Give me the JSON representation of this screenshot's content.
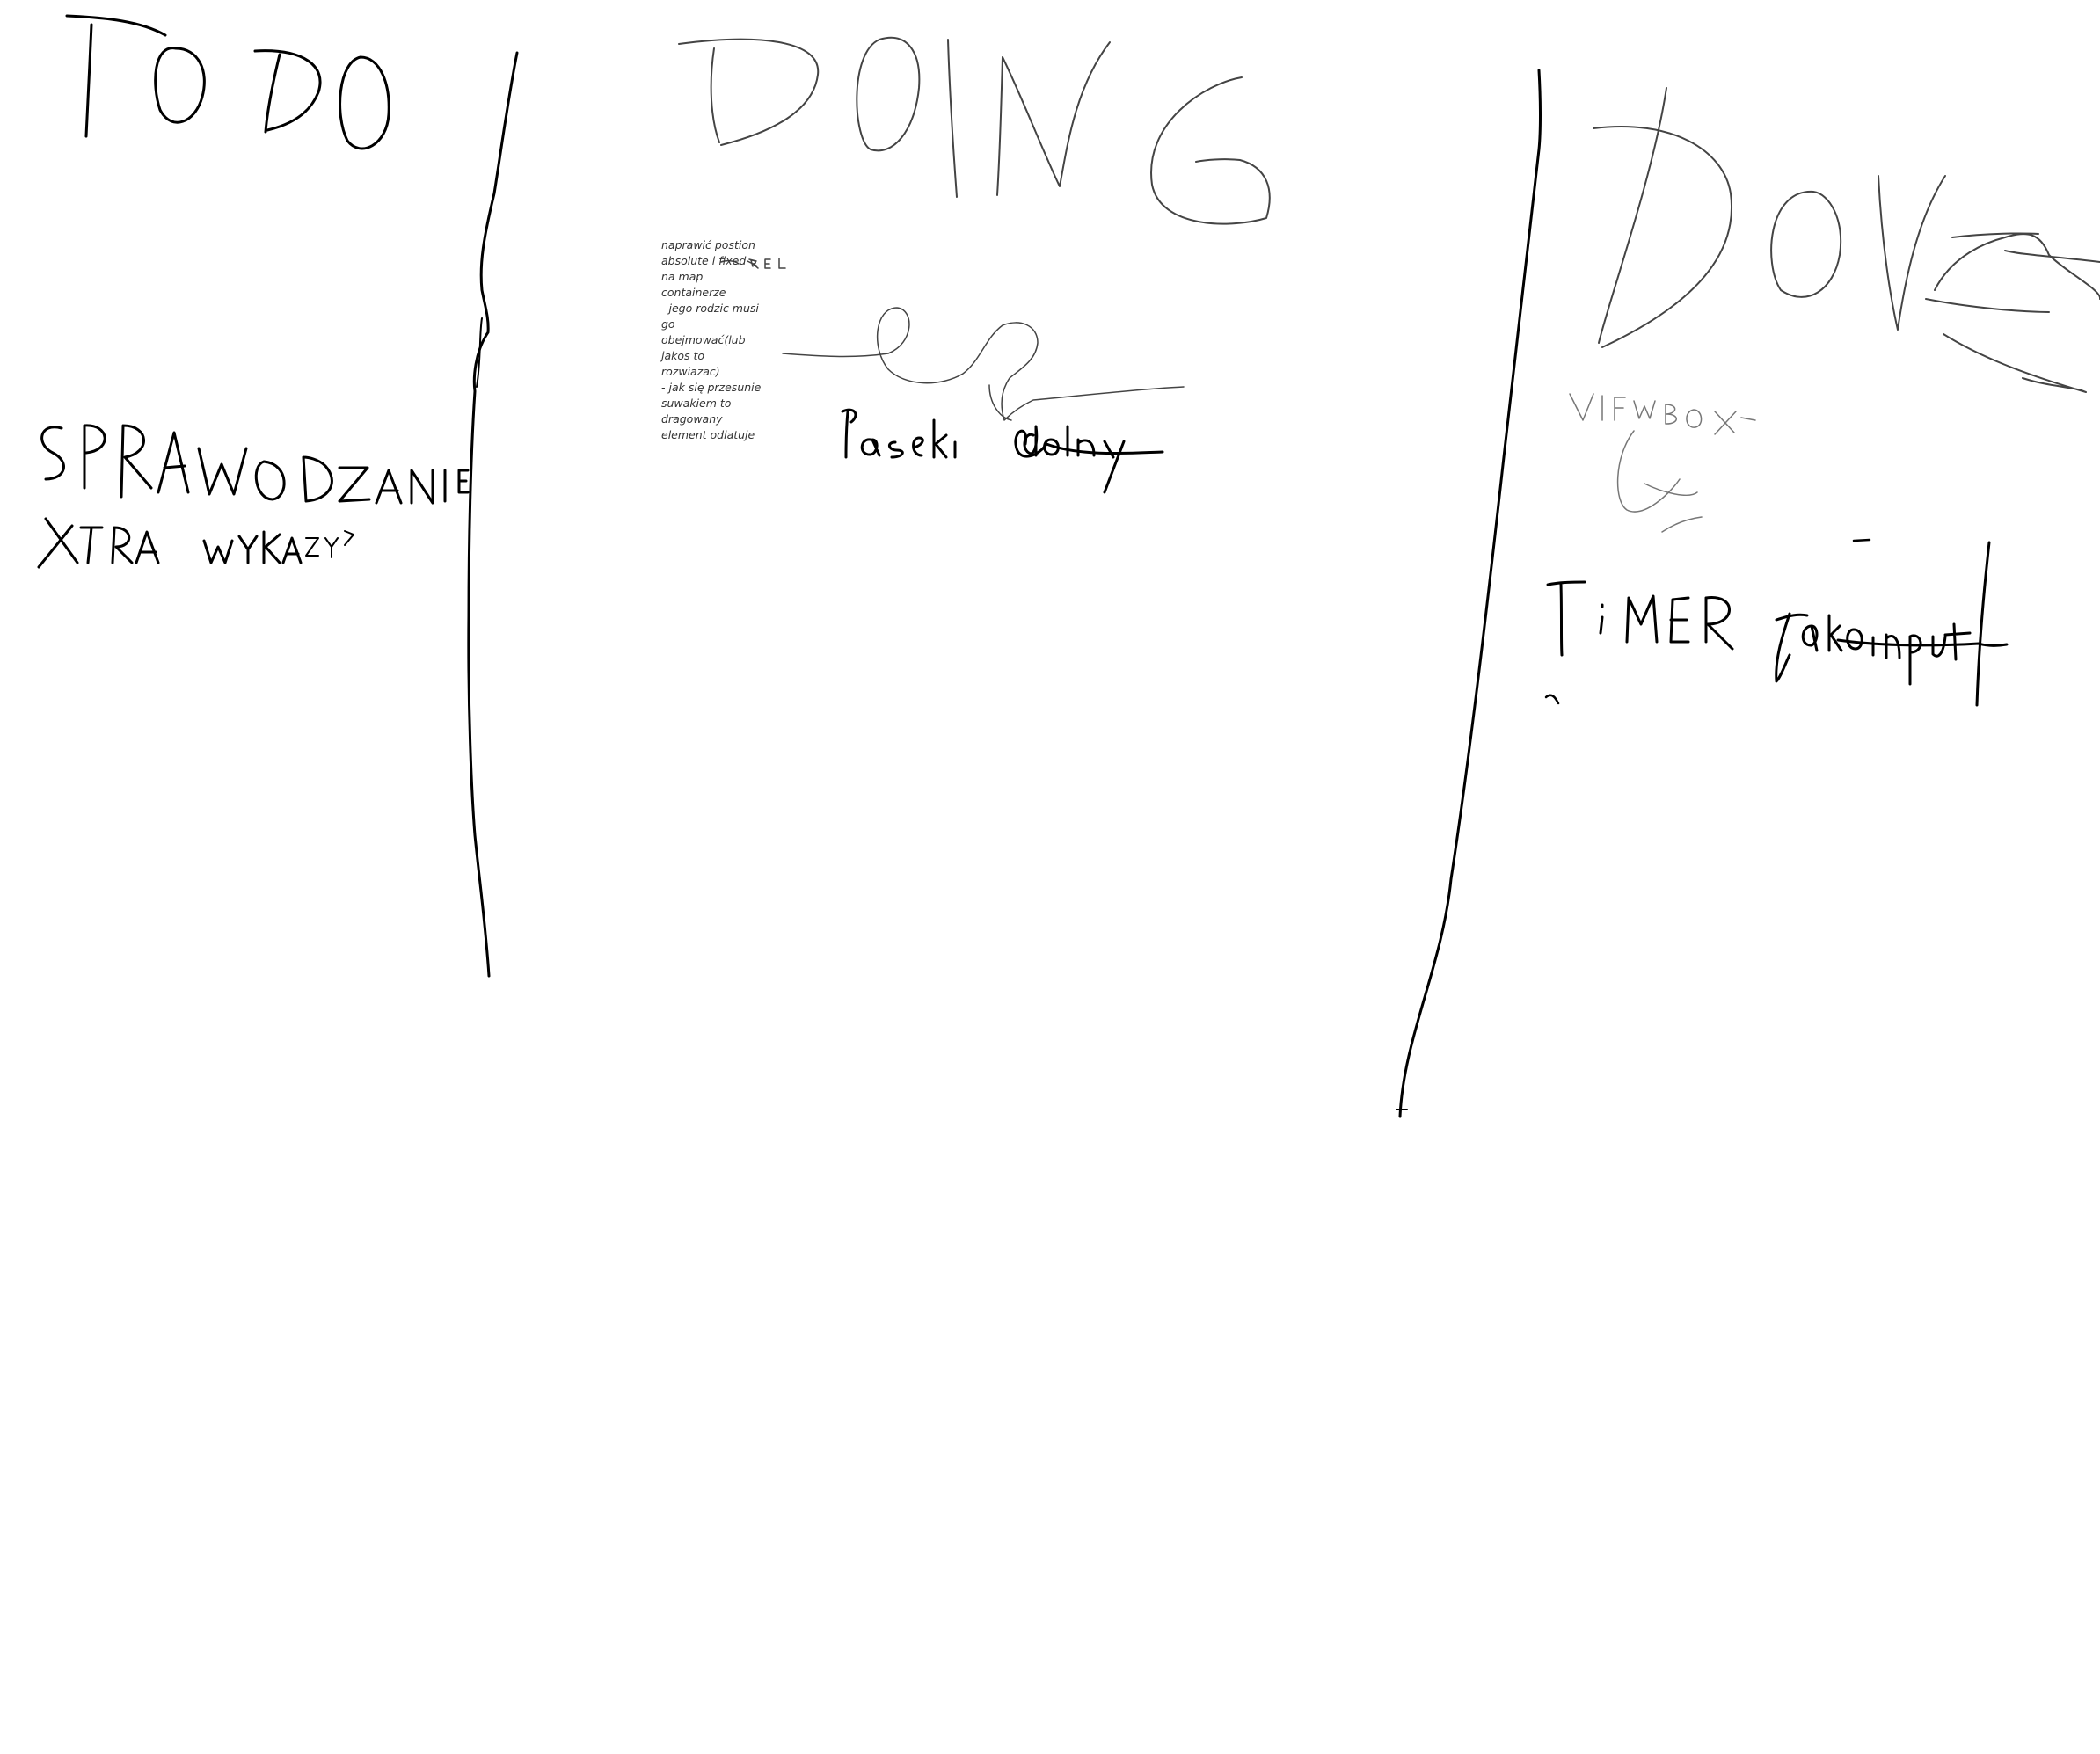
{
  "board": {
    "columns": [
      {
        "heading": "TODO"
      },
      {
        "heading": "DOING"
      },
      {
        "heading": "DONE"
      }
    ],
    "todo_items": [
      "SPRAWOZANIE",
      "XTRA WYKAZY"
    ],
    "doing_note": [
      "naprawić postion",
      "absolute i fixed",
      "na map",
      "containerze",
      "- jego rodzic musi",
      "go",
      "obejmować(lub",
      "jakos to",
      "rozwiazac)",
      "- jak się przesunie",
      "suwakiem to",
      "dragowany",
      "element odlatuje"
    ],
    "doing_annotations": [
      "REL",
      "Pasek dolny"
    ],
    "done_items": [
      "VIEWBOX",
      "TIMER",
      "jako input"
    ]
  },
  "colors": {
    "background": "#ffffff",
    "ink": "#000000",
    "typed_text": "#333333"
  }
}
